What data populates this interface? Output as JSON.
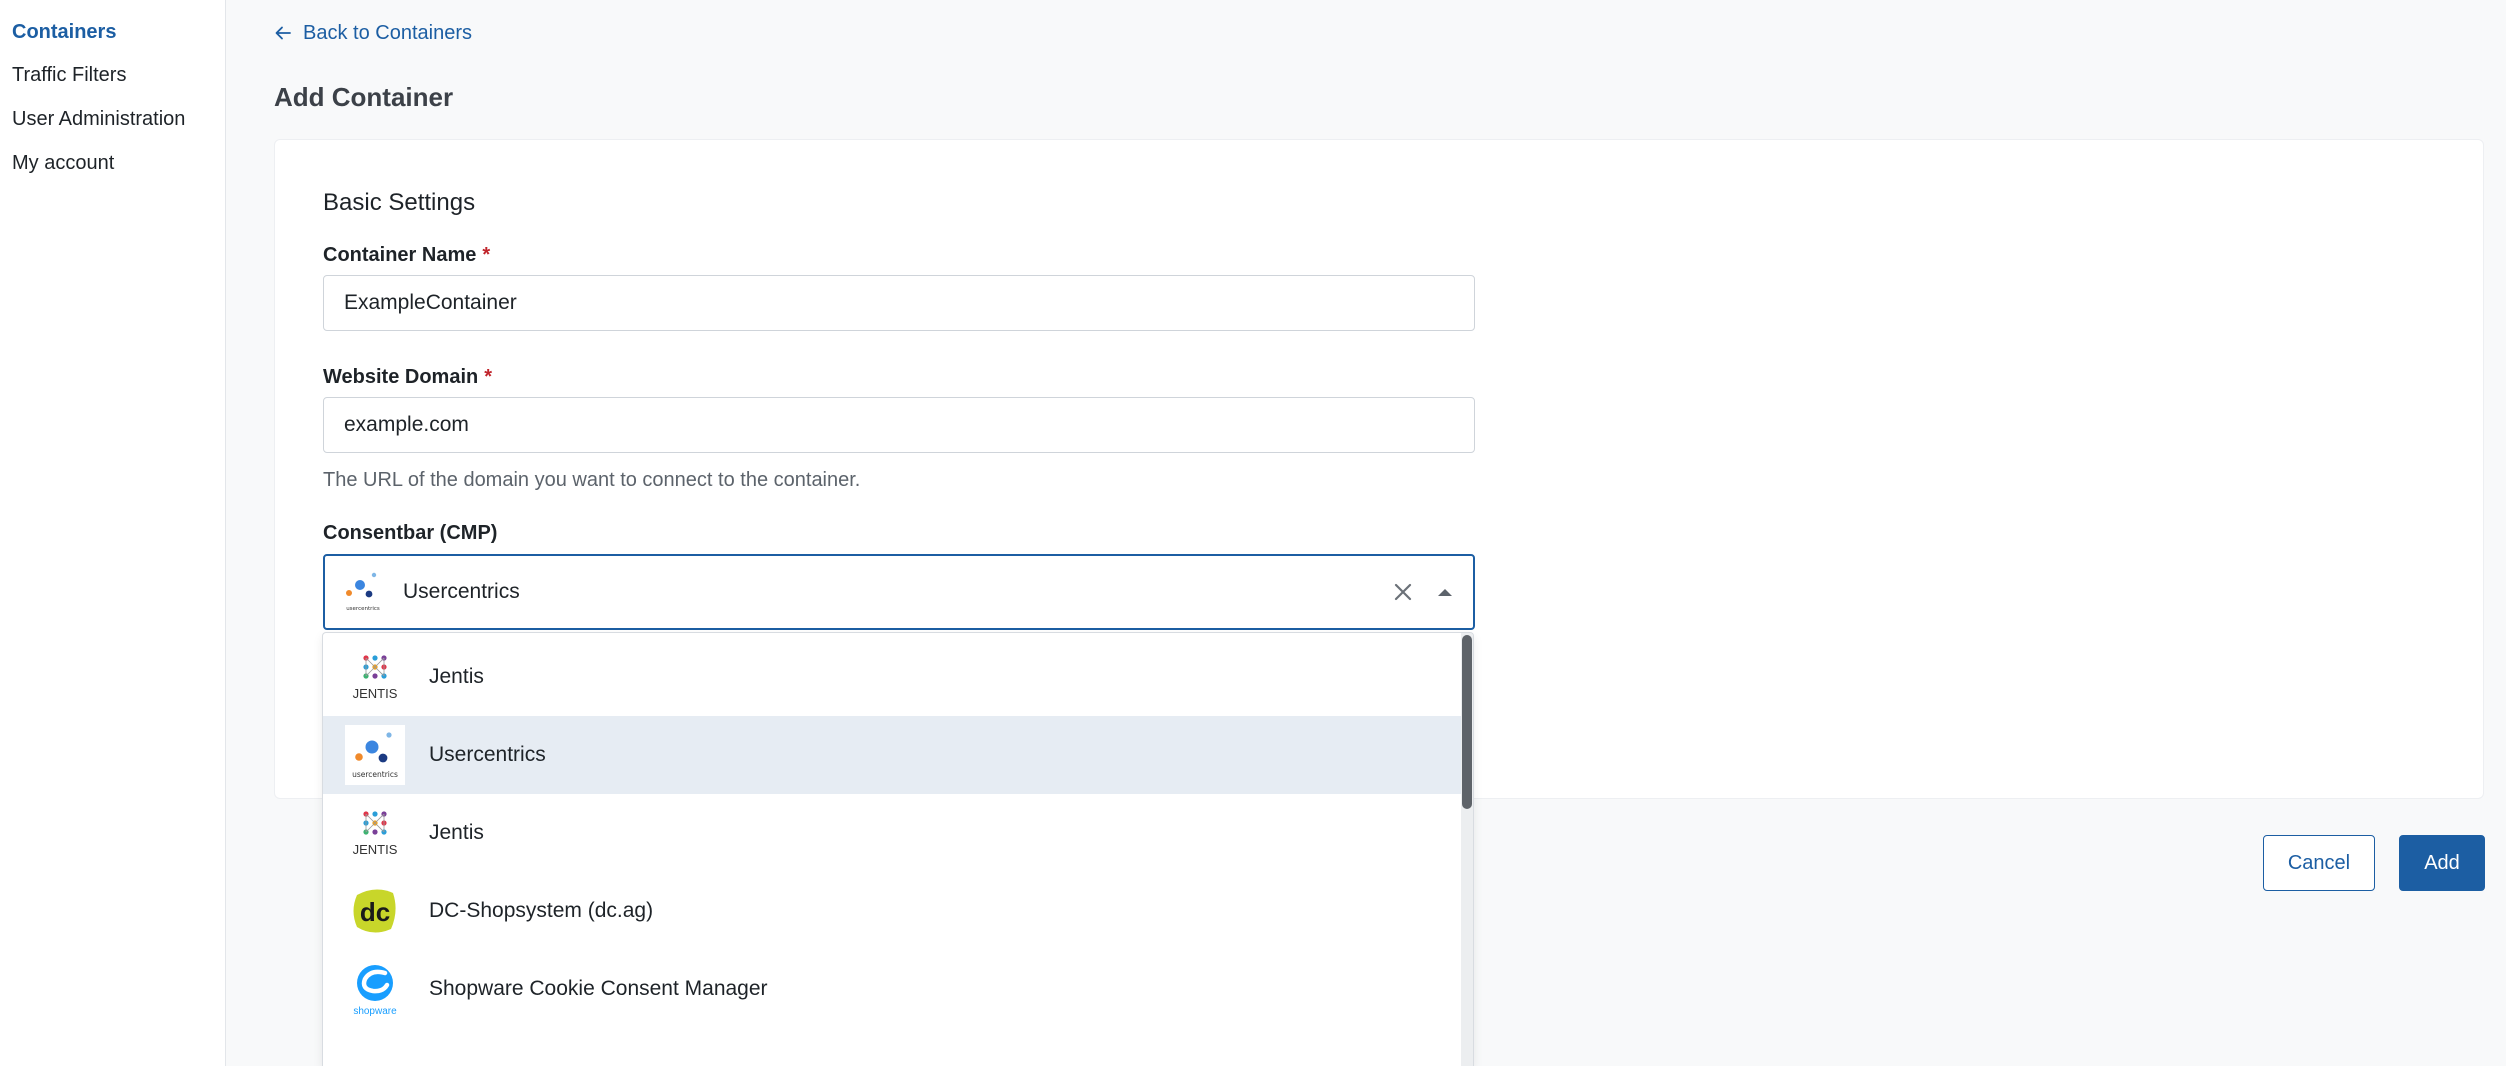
{
  "sidebar": {
    "items": [
      {
        "label": "Containers",
        "active": true
      },
      {
        "label": "Traffic Filters"
      },
      {
        "label": "User Administration"
      },
      {
        "label": "My account"
      }
    ]
  },
  "header": {
    "back_label": "Back to Containers",
    "title": "Add Container"
  },
  "form": {
    "section_title": "Basic Settings",
    "container_name": {
      "label": "Container Name",
      "required_mark": "*",
      "value": "ExampleContainer"
    },
    "website_domain": {
      "label": "Website Domain",
      "required_mark": "*",
      "value": "example.com",
      "help": "The URL of the domain you want to connect to the container."
    },
    "consentbar": {
      "label": "Consentbar (CMP)",
      "value": "Usercentrics"
    }
  },
  "dropdown": {
    "options": [
      {
        "label": "Jentis",
        "icon": "jentis-logo-icon"
      },
      {
        "label": "Usercentrics",
        "icon": "usercentrics-logo-icon",
        "selected": true
      },
      {
        "label": "Jentis",
        "icon": "jentis-logo-icon"
      },
      {
        "label": "DC-Shopsystem (dc.ag)",
        "icon": "dc-logo-icon"
      },
      {
        "label": "Shopware Cookie Consent Manager",
        "icon": "shopware-logo-icon"
      }
    ]
  },
  "logo_text": {
    "usercentrics": "usercentrics",
    "jentis": "JENTIS",
    "dc": "dc",
    "shopware": "shopware"
  },
  "actions": {
    "cancel_label": "Cancel",
    "add_label": "Add"
  },
  "colors": {
    "accent": "#1c5ea3",
    "required": "#c0242b",
    "selected_bg": "#e6ecf3"
  }
}
